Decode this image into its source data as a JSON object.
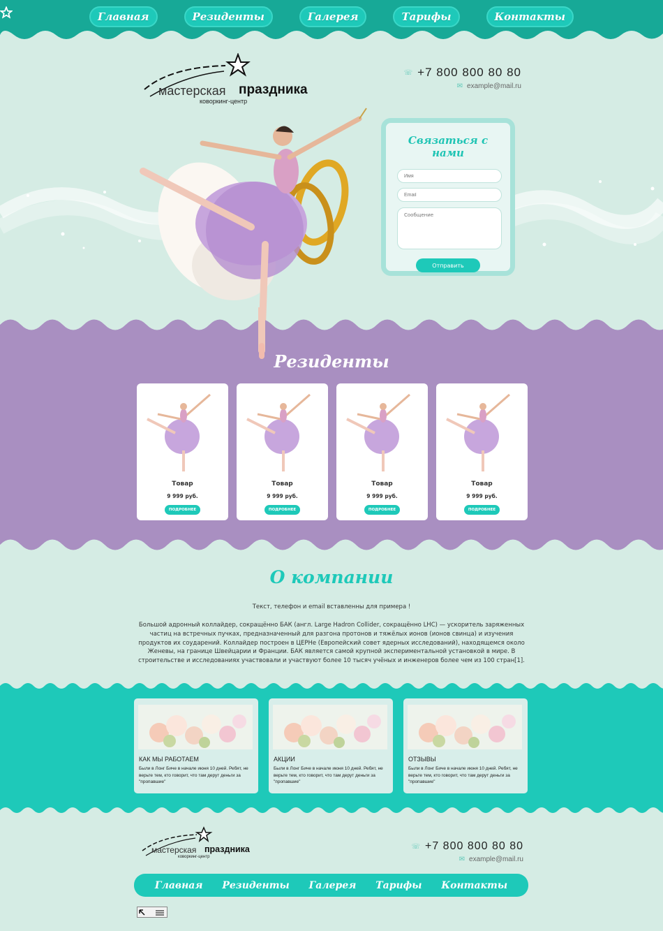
{
  "nav": {
    "items": [
      "Главная",
      "Резиденты",
      "Галерея",
      "Тарифы",
      "Контакты"
    ]
  },
  "logo": {
    "word1": "мастерская",
    "word2": "праздника",
    "subtitle": "коворкинг-центр"
  },
  "contacts": {
    "phone": "+7 800 800 80 80",
    "email": "example@mail.ru"
  },
  "form": {
    "title": "Связаться с нами",
    "name_placeholder": "Имя",
    "email_placeholder": "Email",
    "message_placeholder": "Сообщение",
    "submit_label": "Отправить"
  },
  "residents": {
    "title": "Резиденты",
    "cards": [
      {
        "name": "Товар",
        "price": "9 999 руб.",
        "button": "ПОДРОБНЕЕ"
      },
      {
        "name": "Товар",
        "price": "9 999 руб.",
        "button": "ПОДРОБНЕЕ"
      },
      {
        "name": "Товар",
        "price": "9 999 руб.",
        "button": "ПОДРОБНЕЕ"
      },
      {
        "name": "Товар",
        "price": "9 999 руб.",
        "button": "ПОДРОБНЕЕ"
      }
    ]
  },
  "about": {
    "title": "О компании",
    "note": "Текст, телефон и email вставленны для примера !",
    "text": "Большой адронный коллайдер, сокращённо БАК (англ. Large Hadron Collider, сокращённо LHC) — ускоритель заряженных частиц на встречных пучках, предназначенный для разгона протонов и тяжёлых ионов (ионов свинца) и изучения продуктов их соударений. Коллайдер построен в ЦЕРНе (Европейский совет ядерных исследований), находящемся около Женевы, на границе Швейцарии и Франции. БАК является самой крупной экспериментальной установкой в мире. В строительстве и исследованиях участвовали и участвуют более 10 тысяч учёных и инженеров более чем из 100 стран[1]."
  },
  "info_cards": [
    {
      "title": "КАК МЫ РАБОТАЕМ",
      "text": "Были в Лонг Биче в начале июня 10 дней. Ребят, не верьте тем, кто говорит, что там дерут деньги за \"пропавшие\""
    },
    {
      "title": "АКЦИИ",
      "text": "Были в Лонг Биче в начале июня 10 дней. Ребят, не верьте тем, кто говорит, что там дерут деньги за \"пропавшие\""
    },
    {
      "title": "ОТЗЫВЫ",
      "text": "Были в Лонг Биче в начале июня 10 дней. Ребят, не верьте тем, кто говорит, что там дерут деньги за \"пропавшие\""
    }
  ],
  "footer": {
    "nav": [
      "Главная",
      "Резиденты",
      "Галерея",
      "Тарифы",
      "Контакты"
    ]
  },
  "colors": {
    "teal": "#1ec9b9",
    "dark_teal": "#17a997",
    "purple": "#a98fc1",
    "mint_bg": "#d5ece4"
  }
}
